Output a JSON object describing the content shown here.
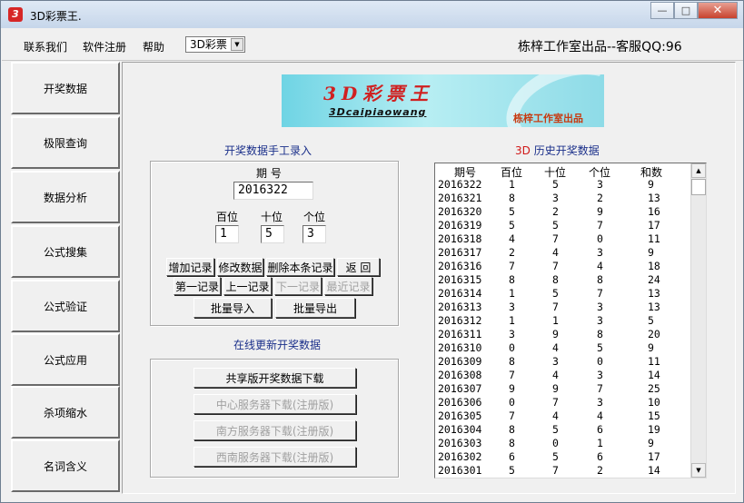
{
  "window": {
    "title": "3D彩票王.",
    "icon_letter": "3",
    "controls": {
      "minimize": "—",
      "maximize": "□",
      "close": "✕"
    }
  },
  "menu": {
    "items": [
      "联系我们",
      "软件注册",
      "帮助"
    ],
    "combo_value": "3D彩票",
    "studio_text": "栋梓工作室出品--客服QQ:96"
  },
  "sidebar": {
    "items": [
      "开奖数据",
      "极限查询",
      "数据分析",
      "公式搜集",
      "公式验证",
      "公式应用",
      "杀项缩水",
      "名词含义"
    ]
  },
  "banner": {
    "title": "3D彩票王",
    "subtitle": "3Dcaipiaowang",
    "credit": "栋梓工作室出品"
  },
  "entry": {
    "title": "开奖数据手工录入",
    "period_label": "期 号",
    "period_value": "2016322",
    "digit_labels": [
      "百位",
      "十位",
      "个位"
    ],
    "digit_values": [
      "1",
      "5",
      "3"
    ],
    "buttons": {
      "add": "增加记录",
      "modify": "修改数据",
      "delete": "删除本条记录",
      "back": "返 回",
      "first": "第一记录",
      "prev": "上一记录",
      "next": "下一记录",
      "latest": "最近记录",
      "batch_import": "批量导入",
      "batch_export": "批量导出"
    }
  },
  "online": {
    "title": "在线更新开奖数据",
    "buttons": {
      "shared": "共享版开奖数据下载",
      "center": "中心服务器下载(注册版)",
      "south": "南方服务器下载(注册版)",
      "southwest": "西南服务器下载(注册版)"
    }
  },
  "history": {
    "title_prefix": "3D",
    "title_rest": " 历史开奖数据",
    "prefix_color": "#d01818",
    "columns": [
      "期号",
      "百位",
      "十位",
      "个位",
      "和数"
    ],
    "rows": [
      [
        "2016322",
        "1",
        "5",
        "3",
        "9"
      ],
      [
        "2016321",
        "8",
        "3",
        "2",
        "13"
      ],
      [
        "2016320",
        "5",
        "2",
        "9",
        "16"
      ],
      [
        "2016319",
        "5",
        "5",
        "7",
        "17"
      ],
      [
        "2016318",
        "4",
        "7",
        "0",
        "11"
      ],
      [
        "2016317",
        "2",
        "4",
        "3",
        "9"
      ],
      [
        "2016316",
        "7",
        "7",
        "4",
        "18"
      ],
      [
        "2016315",
        "8",
        "8",
        "8",
        "24"
      ],
      [
        "2016314",
        "1",
        "5",
        "7",
        "13"
      ],
      [
        "2016313",
        "3",
        "7",
        "3",
        "13"
      ],
      [
        "2016312",
        "1",
        "1",
        "3",
        "5"
      ],
      [
        "2016311",
        "3",
        "9",
        "8",
        "20"
      ],
      [
        "2016310",
        "0",
        "4",
        "5",
        "9"
      ],
      [
        "2016309",
        "8",
        "3",
        "0",
        "11"
      ],
      [
        "2016308",
        "7",
        "4",
        "3",
        "14"
      ],
      [
        "2016307",
        "9",
        "9",
        "7",
        "25"
      ],
      [
        "2016306",
        "0",
        "7",
        "3",
        "10"
      ],
      [
        "2016305",
        "7",
        "4",
        "4",
        "15"
      ],
      [
        "2016304",
        "8",
        "5",
        "6",
        "19"
      ],
      [
        "2016303",
        "8",
        "0",
        "1",
        "9"
      ],
      [
        "2016302",
        "6",
        "5",
        "6",
        "17"
      ],
      [
        "2016301",
        "5",
        "7",
        "2",
        "14"
      ]
    ]
  }
}
